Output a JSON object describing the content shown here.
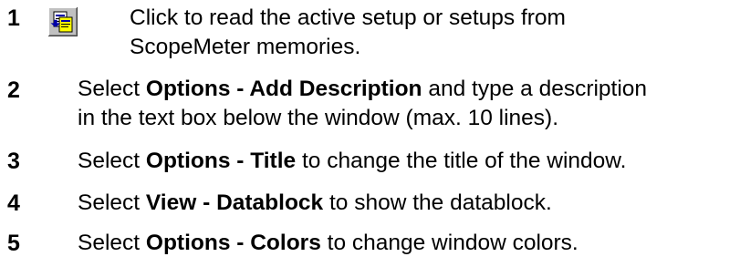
{
  "steps": [
    {
      "number": "1",
      "icon": "read-setups-icon",
      "lines": [
        {
          "text": "Click to read the active setup or setups from"
        },
        {
          "text": "ScopeMeter memories."
        }
      ]
    },
    {
      "number": "2",
      "lines": [
        {
          "pre": "Select ",
          "bold": "Options - Add Description",
          "post": " and type a description"
        },
        {
          "text": "in the text box below the window (max. 10 lines)."
        }
      ]
    },
    {
      "number": "3",
      "pre": "Select ",
      "bold": "Options - Title",
      "post": " to change the title of the window."
    },
    {
      "number": "4",
      "pre": "Select ",
      "bold": "View - Datablock",
      "post": " to show the datablock."
    },
    {
      "number": "5",
      "pre": "Select ",
      "bold": "Options - Colors",
      "post": " to change window colors."
    }
  ],
  "colors": {
    "text": "#000000",
    "icon_face": "#c0c0c0",
    "icon_accent": "#0000a8",
    "icon_paper": "#ffff00"
  }
}
